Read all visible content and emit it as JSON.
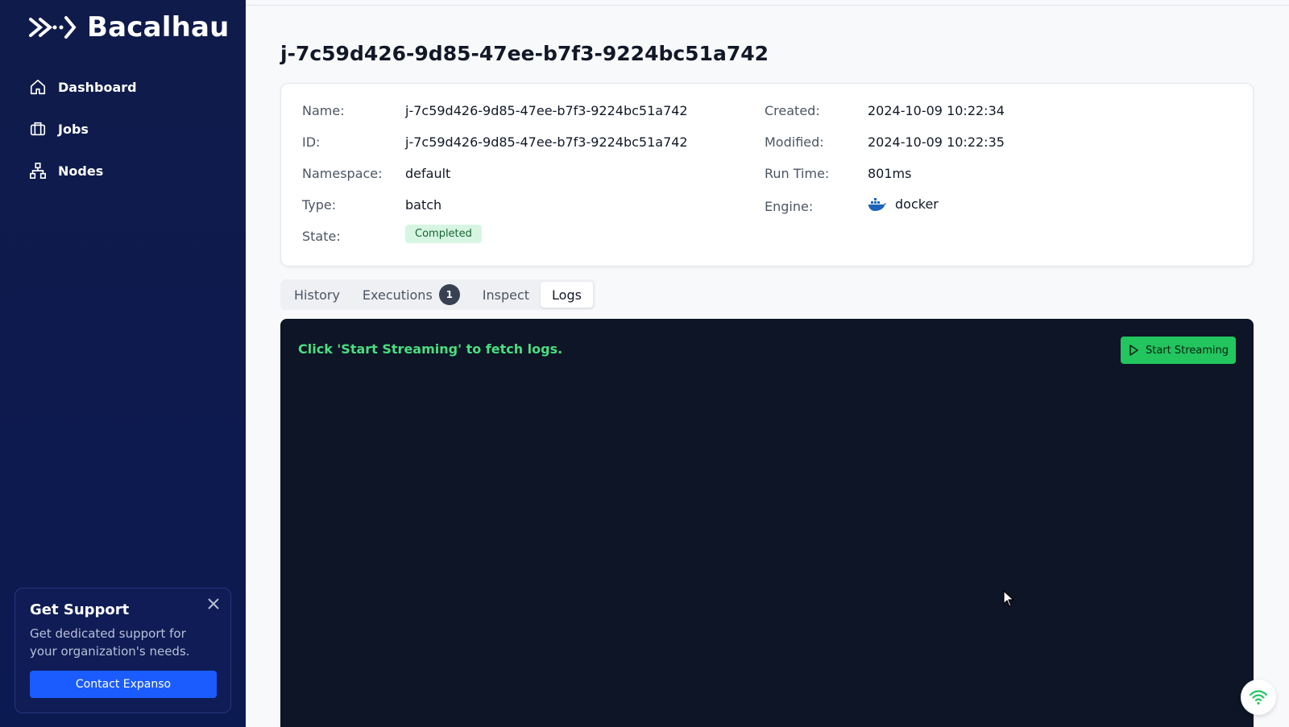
{
  "sidebar": {
    "brand": "Bacalhau",
    "items": [
      {
        "label": "Dashboard",
        "icon": "home-icon"
      },
      {
        "label": "Jobs",
        "icon": "briefcase-icon"
      },
      {
        "label": "Nodes",
        "icon": "network-icon"
      }
    ],
    "support": {
      "title": "Get Support",
      "text": "Get dedicated support for your organization's needs.",
      "button": "Contact Expanso"
    }
  },
  "job": {
    "title": "j-7c59d426-9d85-47ee-b7f3-9224bc51a742",
    "fields": {
      "name_label": "Name:",
      "name": "j-7c59d426-9d85-47ee-b7f3-9224bc51a742",
      "id_label": "ID:",
      "id": "j-7c59d426-9d85-47ee-b7f3-9224bc51a742",
      "namespace_label": "Namespace:",
      "namespace": "default",
      "type_label": "Type:",
      "type": "batch",
      "state_label": "State:",
      "state": "Completed",
      "created_label": "Created:",
      "created": "2024-10-09 10:22:34",
      "modified_label": "Modified:",
      "modified": "2024-10-09 10:22:35",
      "runtime_label": "Run Time:",
      "runtime": "801ms",
      "engine_label": "Engine:",
      "engine": "docker"
    }
  },
  "tabs": [
    {
      "label": "History"
    },
    {
      "label": "Executions",
      "count": "1"
    },
    {
      "label": "Inspect"
    },
    {
      "label": "Logs",
      "active": true
    }
  ],
  "logs": {
    "message": "Click 'Start Streaming' to fetch logs.",
    "button": "Start Streaming"
  },
  "colors": {
    "sidebar_bg": "#0f1b4a",
    "accent_blue": "#1a5cff",
    "accent_green": "#22c55e",
    "log_bg": "#0d1526"
  }
}
